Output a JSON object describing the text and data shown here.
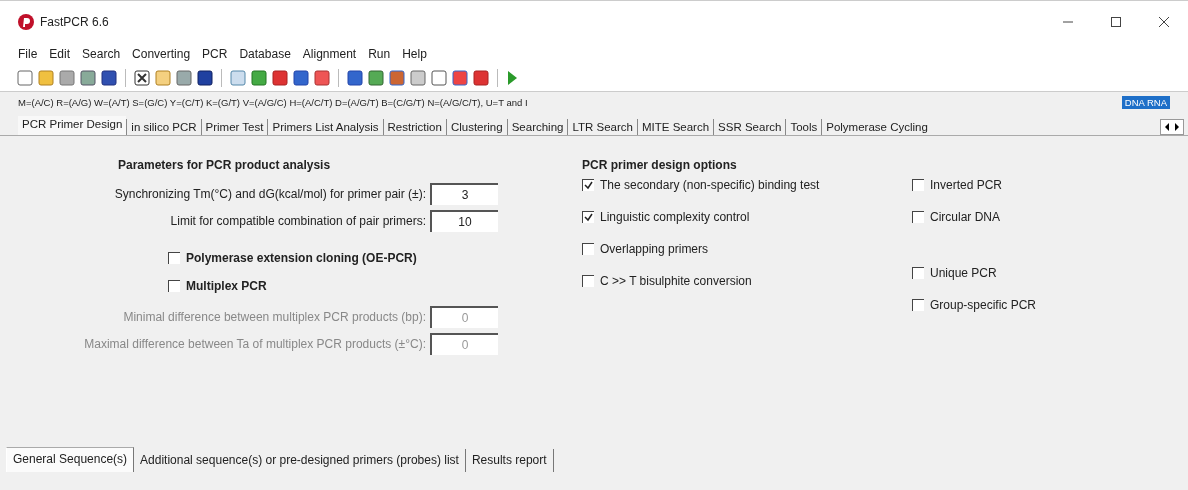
{
  "window": {
    "title": "FastPCR 6.6"
  },
  "menu": [
    "File",
    "Edit",
    "Search",
    "Converting",
    "PCR",
    "Database",
    "Alignment",
    "Run",
    "Help"
  ],
  "code_line": "M=(A/C) R=(A/G) W=(A/T) S=(G/C) Y=(C/T) K=(G/T) V=(A/G/C) H=(A/C/T) D=(A/G/T) B=(C/G/T) N=(A/G/C/T), U=T and I",
  "mode_badge": "DNA RNA",
  "tabs": [
    {
      "label": "PCR Primer Design",
      "selected": true
    },
    {
      "label": "in silico PCR",
      "selected": false
    },
    {
      "label": "Primer Test",
      "selected": false
    },
    {
      "label": "Primers List Analysis",
      "selected": false
    },
    {
      "label": "Restriction",
      "selected": false
    },
    {
      "label": "Clustering",
      "selected": false
    },
    {
      "label": "Searching",
      "selected": false
    },
    {
      "label": "LTR Search",
      "selected": false
    },
    {
      "label": "MITE Search",
      "selected": false
    },
    {
      "label": "SSR Search",
      "selected": false
    },
    {
      "label": "Tools",
      "selected": false
    },
    {
      "label": "Polymerase Cycling",
      "selected": false
    }
  ],
  "left_panel": {
    "heading": "Parameters for PCR product analysis",
    "fields": [
      {
        "label": "Synchronizing Tm(°C) and dG(kcal/mol) for primer pair (±):",
        "value": "3",
        "disabled": false
      },
      {
        "label": "Limit for compatible combination of pair primers:",
        "value": "10",
        "disabled": false
      }
    ],
    "checkboxes": [
      {
        "label": "Polymerase extension cloning (OE-PCR)",
        "checked": false
      },
      {
        "label": "Multiplex PCR",
        "checked": false
      }
    ],
    "multiplex_fields": [
      {
        "label": "Minimal difference between multiplex PCR products (bp):",
        "value": "0",
        "disabled": true
      },
      {
        "label": "Maximal difference between Ta of multiplex PCR products (±°C):",
        "value": "0",
        "disabled": true
      }
    ]
  },
  "right_panel": {
    "heading": "PCR primer design options",
    "column_1": [
      {
        "label": "The secondary (non-specific) binding test",
        "checked": true
      },
      {
        "label": "Linguistic complexity control",
        "checked": true
      },
      {
        "label": "Overlapping primers",
        "checked": false
      },
      {
        "label": "C >> T bisulphite conversion",
        "checked": false
      }
    ],
    "column_2": [
      {
        "label": "Inverted PCR",
        "checked": false
      },
      {
        "label": "Circular DNA",
        "checked": false
      },
      {
        "label": "Unique PCR",
        "checked": false
      },
      {
        "label": "Group-specific PCR",
        "checked": false
      }
    ]
  },
  "bottom_tabs": [
    {
      "label": "General Sequence(s)",
      "selected": true
    },
    {
      "label": "Additional sequence(s) or pre-designed primers (probes) list",
      "selected": false
    },
    {
      "label": "Results report",
      "selected": false
    }
  ]
}
